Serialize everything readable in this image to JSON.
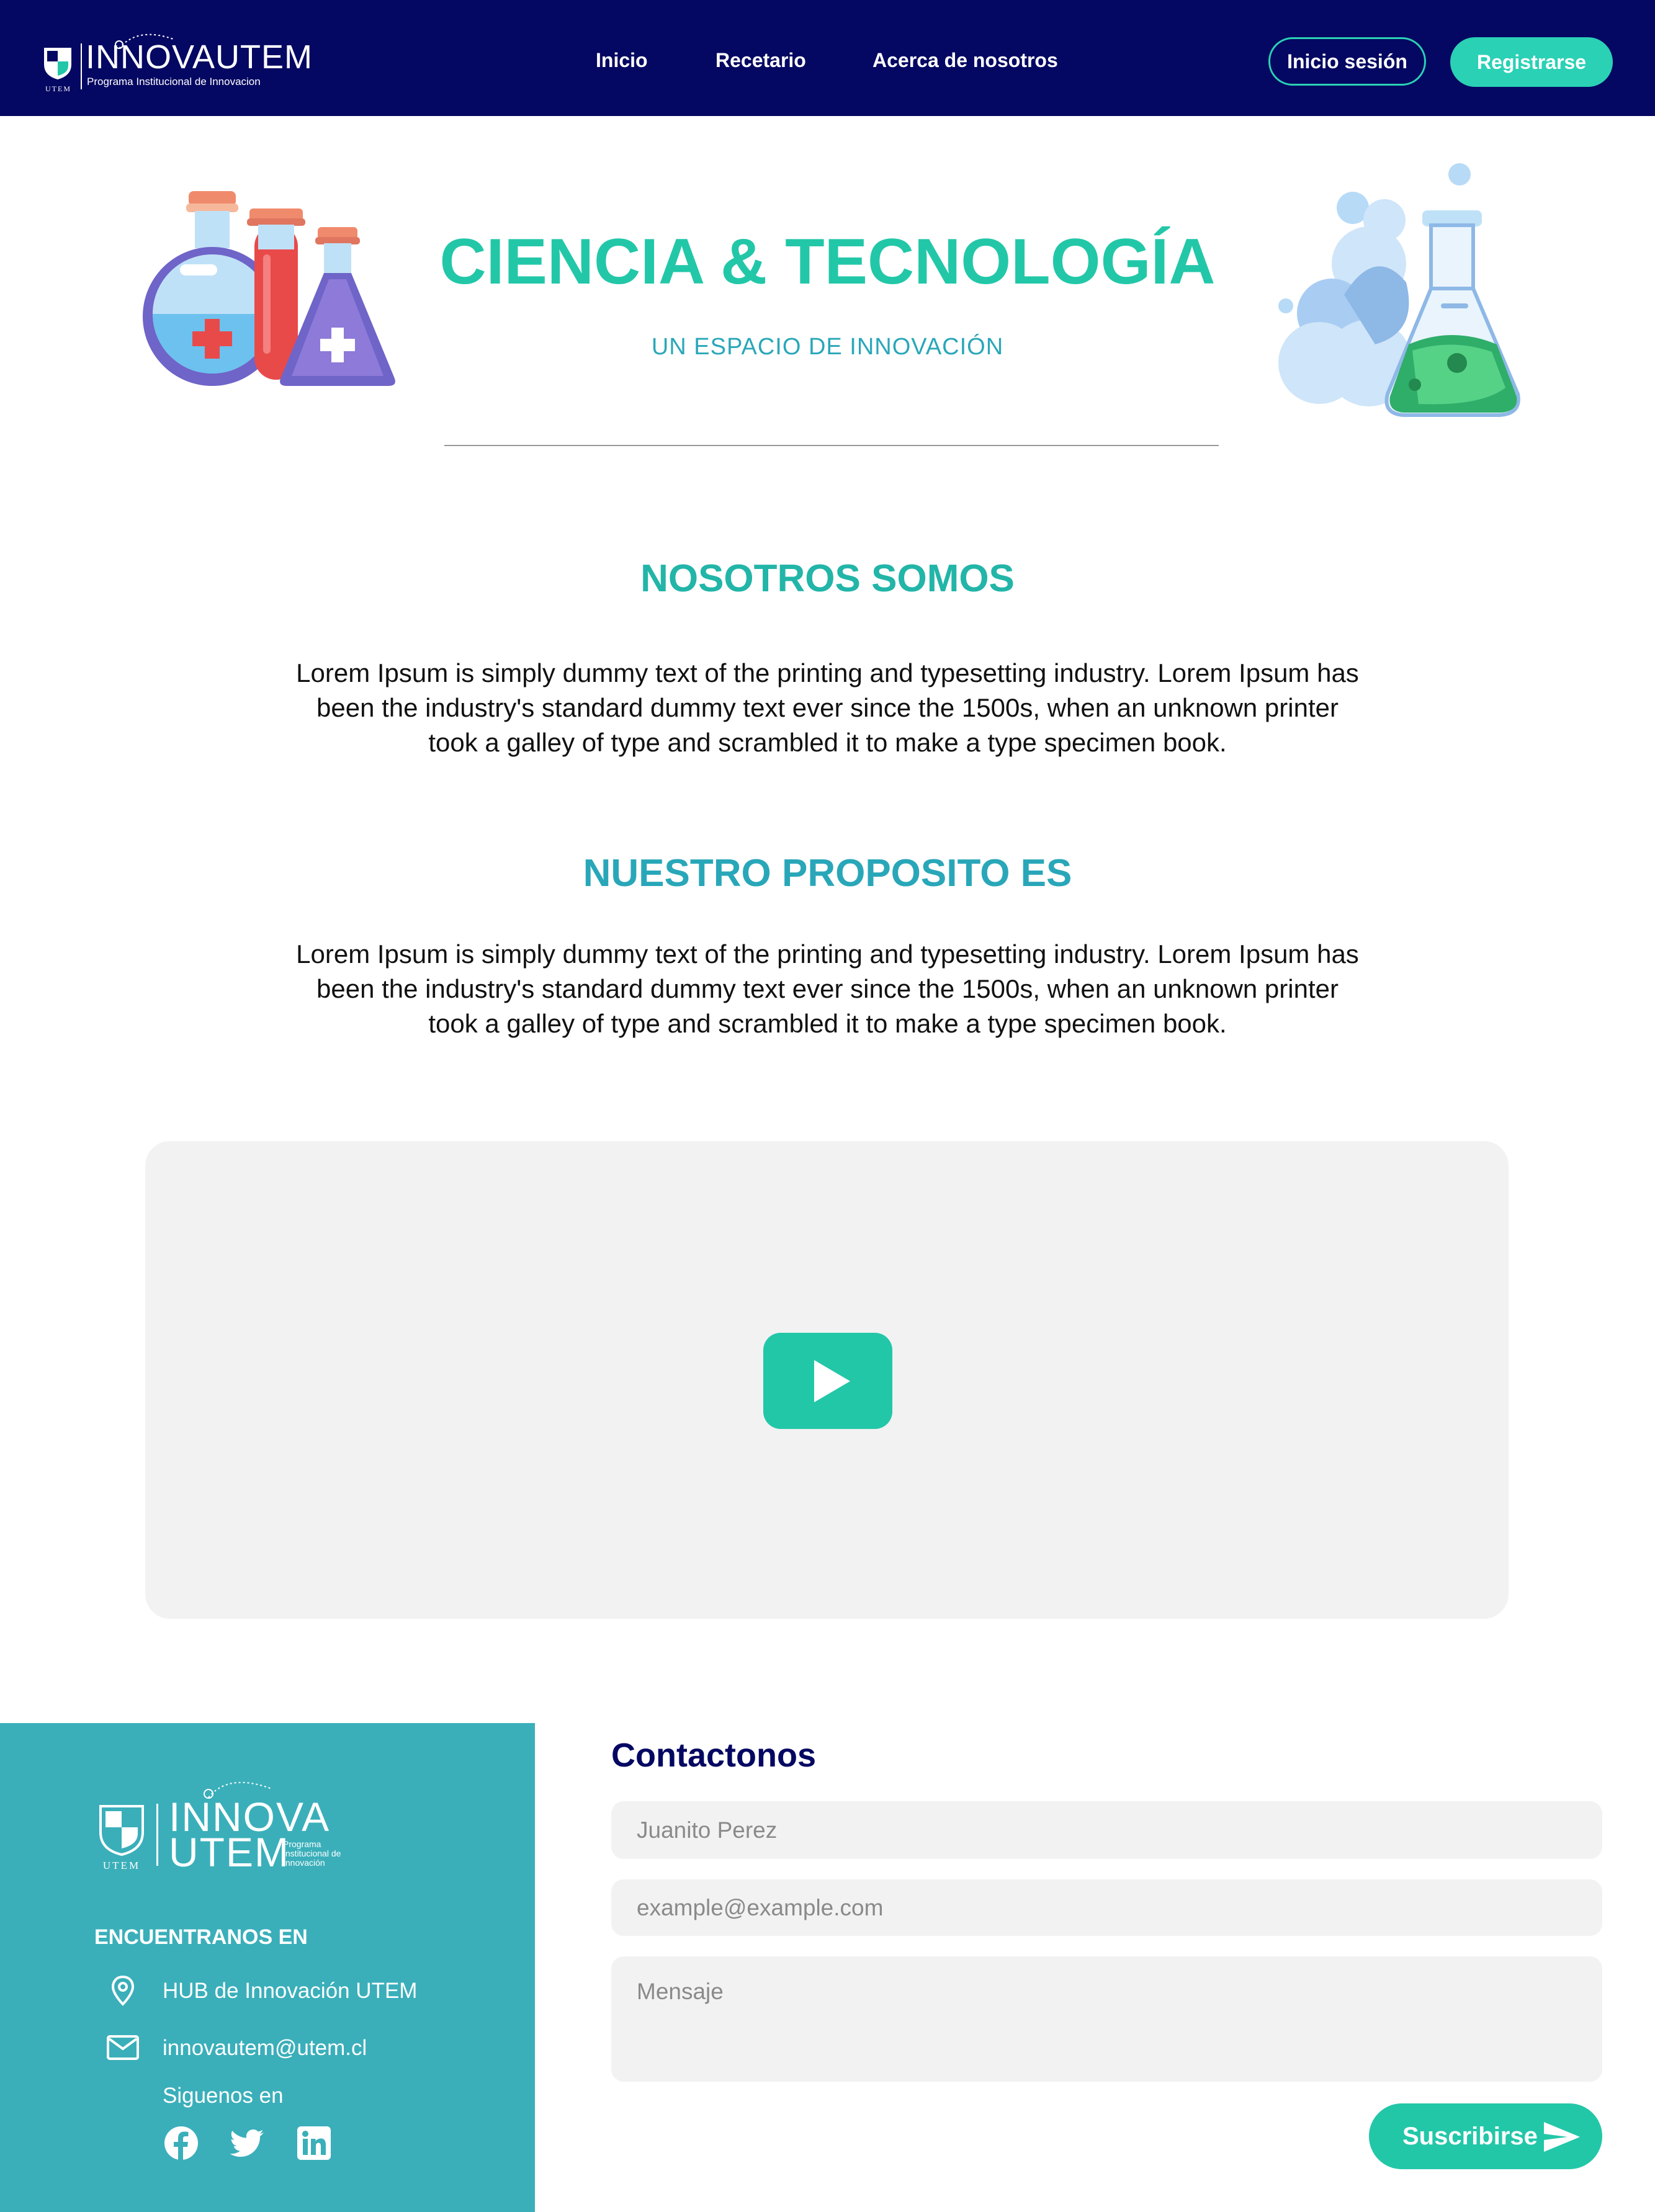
{
  "colors": {
    "navy": "#050862",
    "teal": "#22c7a8",
    "teal_dark": "#29a7b9",
    "footer_bg": "#3aafba",
    "video_bg": "#f2f2f2"
  },
  "navbar": {
    "brand": {
      "title_bold": "INNOVA",
      "title_light": "UTEM",
      "subtitle": "Programa Institucional de Innovacion",
      "shield_text": "UTEM"
    },
    "links": [
      "Inicio",
      "Recetario",
      "Acerca de nosotros"
    ],
    "login_label": "Inicio sesión",
    "register_label": "Registrarse"
  },
  "hero": {
    "title": "CIENCIA & TECNOLOGÍA",
    "subtitle": "UN ESPACIO DE INNOVACIÓN",
    "left_icon": "chemistry-flasks-icon",
    "right_icon": "smoking-flask-icon"
  },
  "sections": [
    {
      "title": "NOSOTROS SOMOS",
      "body": "Lorem Ipsum is simply dummy text of the printing and typesetting industry. Lorem Ipsum has been the industry's standard dummy text ever since the 1500s, when an unknown printer took a galley of type and scrambled it to make a type specimen book."
    },
    {
      "title": "NUESTRO PROPOSITO ES",
      "body": "Lorem Ipsum is simply dummy text of the printing and typesetting industry. Lorem Ipsum has been the industry's standard dummy text ever since the 1500s, when an unknown printer took a galley of type and scrambled it to make a type specimen book."
    }
  ],
  "video": {
    "icon": "play-icon"
  },
  "footer": {
    "logo": {
      "t1": "INNOVA",
      "t2": "UTEM",
      "t3": "Programa Institucional de Innovación",
      "shield_text": "UTEM"
    },
    "find_title": "ENCUENTRANOS EN",
    "location": {
      "icon": "location-pin-icon",
      "text": "HUB de Innovación UTEM"
    },
    "email": {
      "icon": "mail-icon",
      "text": "innovautem@utem.cl"
    },
    "follow_label": "Siguenos en",
    "social": [
      "facebook-icon",
      "twitter-icon",
      "linkedin-icon"
    ]
  },
  "contact": {
    "title": "Contactonos",
    "name_placeholder": "Juanito Perez",
    "email_placeholder": "example@example.com",
    "message_placeholder": "Mensaje",
    "subscribe_label": "Suscribirse",
    "subscribe_icon": "send-icon"
  }
}
